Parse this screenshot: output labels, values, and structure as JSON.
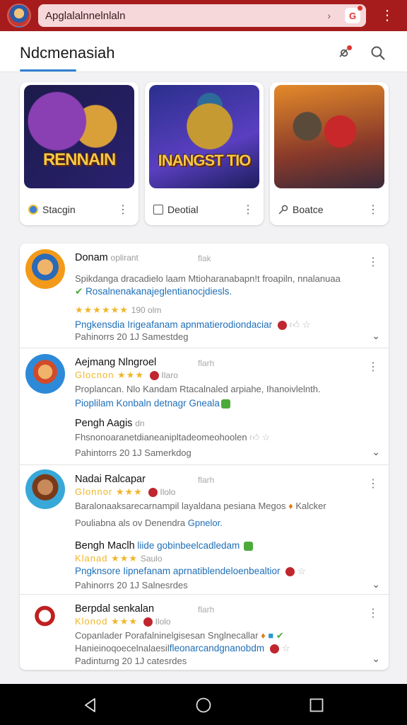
{
  "topbar": {
    "search_value": "Apglalalnnelnlaln",
    "chevron": "›",
    "kebab": "⋮"
  },
  "header": {
    "title": "Ndcmenasiah"
  },
  "cards": [
    {
      "art_title": "RENNAIN",
      "caption": "Stacgin",
      "kebab": "⋮"
    },
    {
      "art_title": "INANGST TIO",
      "caption": "Deotial",
      "kebab": "⋮"
    },
    {
      "art_title": "",
      "caption": "Boatce",
      "kebab": "⋮"
    }
  ],
  "items": [
    {
      "name": "Donam",
      "name_extra": "oplirant",
      "tag": "flak",
      "line2": "Spikdanga dracadielo laam  Mtioharanabapn!t  froapiln, nnalanuaa",
      "line3": "Rosalnenakanajeglentianocjdiesls.",
      "stars": "★★★★★★",
      "rating": "190 olm",
      "line5": "Pngkensdia Irigeafanam apnmatierodiondaciar",
      "footer": "Pahinorrs 20 1J Samestdeg"
    },
    {
      "name": "Aejmang Nlngroel",
      "tag": "flarh",
      "stars_line": "Glocnon ★★★",
      "rating": "Ilaro",
      "line3": "Proplancan. Nlo Kandam  Rtacalnaled  arpiahe, Ihanoivlelnth.",
      "line4": "Pioplilam Konbaln detnagr Gneala",
      "sub_name": "Pengh Aagis",
      "sub_extra": "dn",
      "line6": "Fhsnonoaranetdianeanipltadeomeohoolen",
      "footer": "Pahintorrs 20 1J Samerkdog"
    },
    {
      "name": "Nadai Ralcapar",
      "tag": "flarh",
      "stars_line": "Glonnor ★★★",
      "rating": "Ilolo",
      "line3": "Baralonaaksarecarnampil layaldana pesiana Megos",
      "line3_end": "Kalcker",
      "line4_a": "Pouliabna als ov Denendra",
      "line4_b": "Gpnelor.",
      "sub_name": "Bengh Maclh",
      "sub_blue": "liide gobinbeelcadledam",
      "stars_line2": "Klanad ★★★",
      "rating2": "Saulo",
      "line7": "Pngknsore Iipnefanam aprnatiblendeloenbealtior",
      "footer": "Pahinorrs 20 1J Salnesrdes"
    },
    {
      "name": "Berpdal senkalan",
      "tag": "flarh",
      "stars_line": "Klonod ★★★",
      "rating": "Ilolo",
      "line3": "Copanlader Porafalninelgisesan Snglnecallar",
      "line4_a": "Hanieinoqoecelnalaesil",
      "line4_b": "fleonarcandgnanobdm",
      "footer": "Padinturng 20 1J catesrdes"
    }
  ],
  "colors": {
    "topbar": "#a61c1c",
    "accent": "#2e7fd0",
    "link_blue": "#1f6fb8",
    "star": "#f0b62a"
  }
}
